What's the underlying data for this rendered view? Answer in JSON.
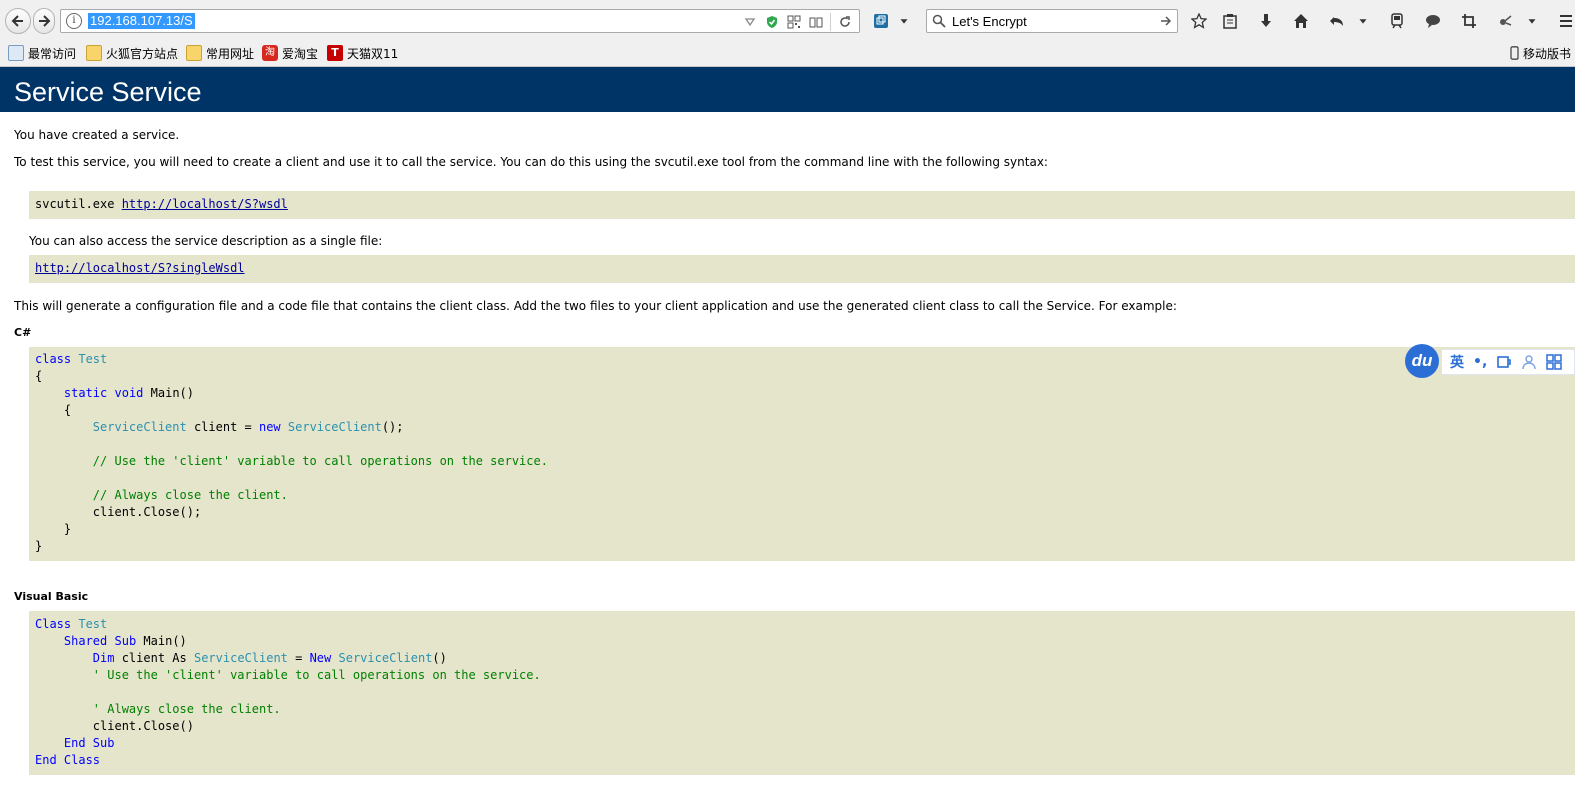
{
  "browser": {
    "url": "192.168.107.13/S",
    "search_value": "Let's Encrypt",
    "bookmarks": [
      {
        "label": "最常访问"
      },
      {
        "label": "火狐官方站点"
      },
      {
        "label": "常用网址"
      },
      {
        "label": "爱淘宝",
        "icon_text": "淘"
      },
      {
        "label": "天猫双11",
        "icon_text": "T"
      }
    ],
    "mobile_bookmarks_label": "移动版书"
  },
  "page": {
    "title": "Service Service",
    "intro": "You have created a service.",
    "test_instructions": "To test this service, you will need to create a client and use it to call the service. You can do this using the svcutil.exe tool from the command line with the following syntax:",
    "svcutil_cmd": "svcutil.exe ",
    "wsdl_link": "http://localhost/S?wsdl",
    "single_file_text": "You can also access the service description as a single file:",
    "single_wsdl_link": "http://localhost/S?singleWsdl",
    "generate_text": "This will generate a configuration file and a code file that contains the client class. Add the two files to your client application and use the generated client class to call the Service. For example:",
    "csharp_label": "C#",
    "vb_label": "Visual Basic"
  },
  "csharp_code": {
    "class_kw": "class",
    "class_name": "Test",
    "open_brace": "{",
    "close_brace": "}",
    "static_kw": "static",
    "void_kw": "void",
    "main": "Main()",
    "inner_open": "{",
    "inner_close": "}",
    "client_type": "ServiceClient",
    "client_decl": " client = ",
    "new_kw": "new",
    "client_ctor": "ServiceClient",
    "ctor_tail": "();",
    "comment1": "// Use the 'client' variable to call operations on the service.",
    "comment2": "// Always close the client.",
    "close_call": "client.Close();"
  },
  "vb_code": {
    "class_kw": "Class",
    "class_name": "Test",
    "shared_kw": "Shared",
    "sub_kw": "Sub",
    "main": "Main()",
    "dim_kw": "Dim",
    "dim_mid": " client As ",
    "client_type": "ServiceClient",
    "eq": " = ",
    "new_kw": "New",
    "client_ctor": "ServiceClient",
    "ctor_tail": "()",
    "comment1": "' Use the 'client' variable to call operations on the service.",
    "comment2": "' Always close the client.",
    "close_call": "client.Close()",
    "end_sub": "End Sub",
    "end_class": "End Class"
  },
  "ime": {
    "logo": "du",
    "mode": "英",
    "punct": "•,"
  },
  "colors": {
    "header_bg": "#003366",
    "code_bg": "#e5e5cc",
    "keyword": "#0000ff",
    "type": "#2b91af",
    "comment": "#008000",
    "link": "#000099"
  }
}
